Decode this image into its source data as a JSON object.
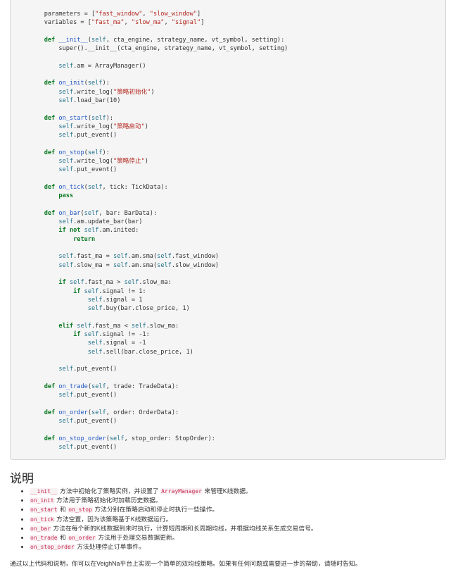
{
  "code_lines": [
    [
      {
        "t": "    parameters = ["
      },
      {
        "t": "\"fast_window\"",
        "c": "st"
      },
      {
        "t": ", "
      },
      {
        "t": "\"slow_window\"",
        "c": "st"
      },
      {
        "t": "]"
      }
    ],
    [
      {
        "t": "    variables = ["
      },
      {
        "t": "\"fast_ma\"",
        "c": "st"
      },
      {
        "t": ", "
      },
      {
        "t": "\"slow_ma\"",
        "c": "st"
      },
      {
        "t": ", "
      },
      {
        "t": "\"signal\"",
        "c": "st"
      },
      {
        "t": "]"
      }
    ],
    [],
    [
      {
        "t": "    "
      },
      {
        "t": "def",
        "c": "kw"
      },
      {
        "t": " "
      },
      {
        "t": "__init__",
        "c": "fn"
      },
      {
        "t": "("
      },
      {
        "t": "self",
        "c": "sf"
      },
      {
        "t": ", cta_engine, strategy_name, vt_symbol, setting):"
      }
    ],
    [
      {
        "t": "        super().__init__(cta_engine, strategy_name, vt_symbol, setting)"
      }
    ],
    [],
    [
      {
        "t": "        "
      },
      {
        "t": "self",
        "c": "sf"
      },
      {
        "t": ".am = ArrayManager()"
      }
    ],
    [],
    [
      {
        "t": "    "
      },
      {
        "t": "def",
        "c": "kw"
      },
      {
        "t": " "
      },
      {
        "t": "on_init",
        "c": "fn"
      },
      {
        "t": "("
      },
      {
        "t": "self",
        "c": "sf"
      },
      {
        "t": "):"
      }
    ],
    [
      {
        "t": "        "
      },
      {
        "t": "self",
        "c": "sf"
      },
      {
        "t": ".write_log("
      },
      {
        "t": "\"策略初始化\"",
        "c": "st"
      },
      {
        "t": ")"
      }
    ],
    [
      {
        "t": "        "
      },
      {
        "t": "self",
        "c": "sf"
      },
      {
        "t": ".load_bar(10)"
      }
    ],
    [],
    [
      {
        "t": "    "
      },
      {
        "t": "def",
        "c": "kw"
      },
      {
        "t": " "
      },
      {
        "t": "on_start",
        "c": "fn"
      },
      {
        "t": "("
      },
      {
        "t": "self",
        "c": "sf"
      },
      {
        "t": "):"
      }
    ],
    [
      {
        "t": "        "
      },
      {
        "t": "self",
        "c": "sf"
      },
      {
        "t": ".write_log("
      },
      {
        "t": "\"策略启动\"",
        "c": "st"
      },
      {
        "t": ")"
      }
    ],
    [
      {
        "t": "        "
      },
      {
        "t": "self",
        "c": "sf"
      },
      {
        "t": ".put_event()"
      }
    ],
    [],
    [
      {
        "t": "    "
      },
      {
        "t": "def",
        "c": "kw"
      },
      {
        "t": " "
      },
      {
        "t": "on_stop",
        "c": "fn"
      },
      {
        "t": "("
      },
      {
        "t": "self",
        "c": "sf"
      },
      {
        "t": "):"
      }
    ],
    [
      {
        "t": "        "
      },
      {
        "t": "self",
        "c": "sf"
      },
      {
        "t": ".write_log("
      },
      {
        "t": "\"策略停止\"",
        "c": "st"
      },
      {
        "t": ")"
      }
    ],
    [
      {
        "t": "        "
      },
      {
        "t": "self",
        "c": "sf"
      },
      {
        "t": ".put_event()"
      }
    ],
    [],
    [
      {
        "t": "    "
      },
      {
        "t": "def",
        "c": "kw"
      },
      {
        "t": " "
      },
      {
        "t": "on_tick",
        "c": "fn"
      },
      {
        "t": "("
      },
      {
        "t": "self",
        "c": "sf"
      },
      {
        "t": ", tick: TickData):"
      }
    ],
    [
      {
        "t": "        "
      },
      {
        "t": "pass",
        "c": "kw"
      }
    ],
    [],
    [
      {
        "t": "    "
      },
      {
        "t": "def",
        "c": "kw"
      },
      {
        "t": " "
      },
      {
        "t": "on_bar",
        "c": "fn"
      },
      {
        "t": "("
      },
      {
        "t": "self",
        "c": "sf"
      },
      {
        "t": ", bar: BarData):"
      }
    ],
    [
      {
        "t": "        "
      },
      {
        "t": "self",
        "c": "sf"
      },
      {
        "t": ".am.update_bar(bar)"
      }
    ],
    [
      {
        "t": "        "
      },
      {
        "t": "if",
        "c": "kw"
      },
      {
        "t": " "
      },
      {
        "t": "not",
        "c": "kw"
      },
      {
        "t": " "
      },
      {
        "t": "self",
        "c": "sf"
      },
      {
        "t": ".am.inited:"
      }
    ],
    [
      {
        "t": "            "
      },
      {
        "t": "return",
        "c": "kw"
      }
    ],
    [],
    [
      {
        "t": "        "
      },
      {
        "t": "self",
        "c": "sf"
      },
      {
        "t": ".fast_ma = "
      },
      {
        "t": "self",
        "c": "sf"
      },
      {
        "t": ".am.sma("
      },
      {
        "t": "self",
        "c": "sf"
      },
      {
        "t": ".fast_window)"
      }
    ],
    [
      {
        "t": "        "
      },
      {
        "t": "self",
        "c": "sf"
      },
      {
        "t": ".slow_ma = "
      },
      {
        "t": "self",
        "c": "sf"
      },
      {
        "t": ".am.sma("
      },
      {
        "t": "self",
        "c": "sf"
      },
      {
        "t": ".slow_window)"
      }
    ],
    [],
    [
      {
        "t": "        "
      },
      {
        "t": "if",
        "c": "kw"
      },
      {
        "t": " "
      },
      {
        "t": "self",
        "c": "sf"
      },
      {
        "t": ".fast_ma > "
      },
      {
        "t": "self",
        "c": "sf"
      },
      {
        "t": ".slow_ma:"
      }
    ],
    [
      {
        "t": "            "
      },
      {
        "t": "if",
        "c": "kw"
      },
      {
        "t": " "
      },
      {
        "t": "self",
        "c": "sf"
      },
      {
        "t": ".signal != 1:"
      }
    ],
    [
      {
        "t": "                "
      },
      {
        "t": "self",
        "c": "sf"
      },
      {
        "t": ".signal = 1"
      }
    ],
    [
      {
        "t": "                "
      },
      {
        "t": "self",
        "c": "sf"
      },
      {
        "t": ".buy(bar.close_price, 1)"
      }
    ],
    [],
    [
      {
        "t": "        "
      },
      {
        "t": "elif",
        "c": "kw"
      },
      {
        "t": " "
      },
      {
        "t": "self",
        "c": "sf"
      },
      {
        "t": ".fast_ma < "
      },
      {
        "t": "self",
        "c": "sf"
      },
      {
        "t": ".slow_ma:"
      }
    ],
    [
      {
        "t": "            "
      },
      {
        "t": "if",
        "c": "kw"
      },
      {
        "t": " "
      },
      {
        "t": "self",
        "c": "sf"
      },
      {
        "t": ".signal != -1:"
      }
    ],
    [
      {
        "t": "                "
      },
      {
        "t": "self",
        "c": "sf"
      },
      {
        "t": ".signal = -1"
      }
    ],
    [
      {
        "t": "                "
      },
      {
        "t": "self",
        "c": "sf"
      },
      {
        "t": ".sell(bar.close_price, 1)"
      }
    ],
    [],
    [
      {
        "t": "        "
      },
      {
        "t": "self",
        "c": "sf"
      },
      {
        "t": ".put_event()"
      }
    ],
    [],
    [
      {
        "t": "    "
      },
      {
        "t": "def",
        "c": "kw"
      },
      {
        "t": " "
      },
      {
        "t": "on_trade",
        "c": "fn"
      },
      {
        "t": "("
      },
      {
        "t": "self",
        "c": "sf"
      },
      {
        "t": ", trade: TradeData):"
      }
    ],
    [
      {
        "t": "        "
      },
      {
        "t": "self",
        "c": "sf"
      },
      {
        "t": ".put_event()"
      }
    ],
    [],
    [
      {
        "t": "    "
      },
      {
        "t": "def",
        "c": "kw"
      },
      {
        "t": " "
      },
      {
        "t": "on_order",
        "c": "fn"
      },
      {
        "t": "("
      },
      {
        "t": "self",
        "c": "sf"
      },
      {
        "t": ", order: OrderData):"
      }
    ],
    [
      {
        "t": "        "
      },
      {
        "t": "self",
        "c": "sf"
      },
      {
        "t": ".put_event()"
      }
    ],
    [],
    [
      {
        "t": "    "
      },
      {
        "t": "def",
        "c": "kw"
      },
      {
        "t": " "
      },
      {
        "t": "on_stop_order",
        "c": "fn"
      },
      {
        "t": "("
      },
      {
        "t": "self",
        "c": "sf"
      },
      {
        "t": ", stop_order: StopOrder):"
      }
    ],
    [
      {
        "t": "        "
      },
      {
        "t": "self",
        "c": "sf"
      },
      {
        "t": ".put_event()"
      }
    ]
  ],
  "section_title": "说明",
  "notes": [
    [
      {
        "c": "__init__"
      },
      {
        "t": " 方法中初始化了策略实例，并设置了 "
      },
      {
        "c": "ArrayManager"
      },
      {
        "t": " 来管理K线数据。"
      }
    ],
    [
      {
        "c": "on_init"
      },
      {
        "t": " 方法用于策略初始化时加载历史数据。"
      }
    ],
    [
      {
        "c": "on_start"
      },
      {
        "t": " 和 "
      },
      {
        "c": "on_stop"
      },
      {
        "t": " 方法分别在策略启动和停止时执行一些操作。"
      }
    ],
    [
      {
        "c": "on_tick"
      },
      {
        "t": " 方法空置，因为该策略基于K线数据运行。"
      }
    ],
    [
      {
        "c": "on_bar"
      },
      {
        "t": " 方法在每个新的K线数据到来时执行，计算短周期和长周期均线，并根据均线关系生成交易信号。"
      }
    ],
    [
      {
        "c": "on_trade"
      },
      {
        "t": " 和 "
      },
      {
        "c": "on_order"
      },
      {
        "t": " 方法用于处理交易数据更新。"
      }
    ],
    [
      {
        "c": "on_stop_order"
      },
      {
        "t": " 方法处理停止订单事件。"
      }
    ]
  ],
  "closing_text": "通过以上代码和说明，你可以在VeighNa平台上实现一个简单的双均线策略。如果有任何问题或需要进一步的帮助，请随时告知。",
  "colors": {
    "keyword": "#0b7a23",
    "function_name": "#1f55c4",
    "string": "#b3261e",
    "self": "#1f6f8a",
    "inline_code": "#c7254e"
  }
}
